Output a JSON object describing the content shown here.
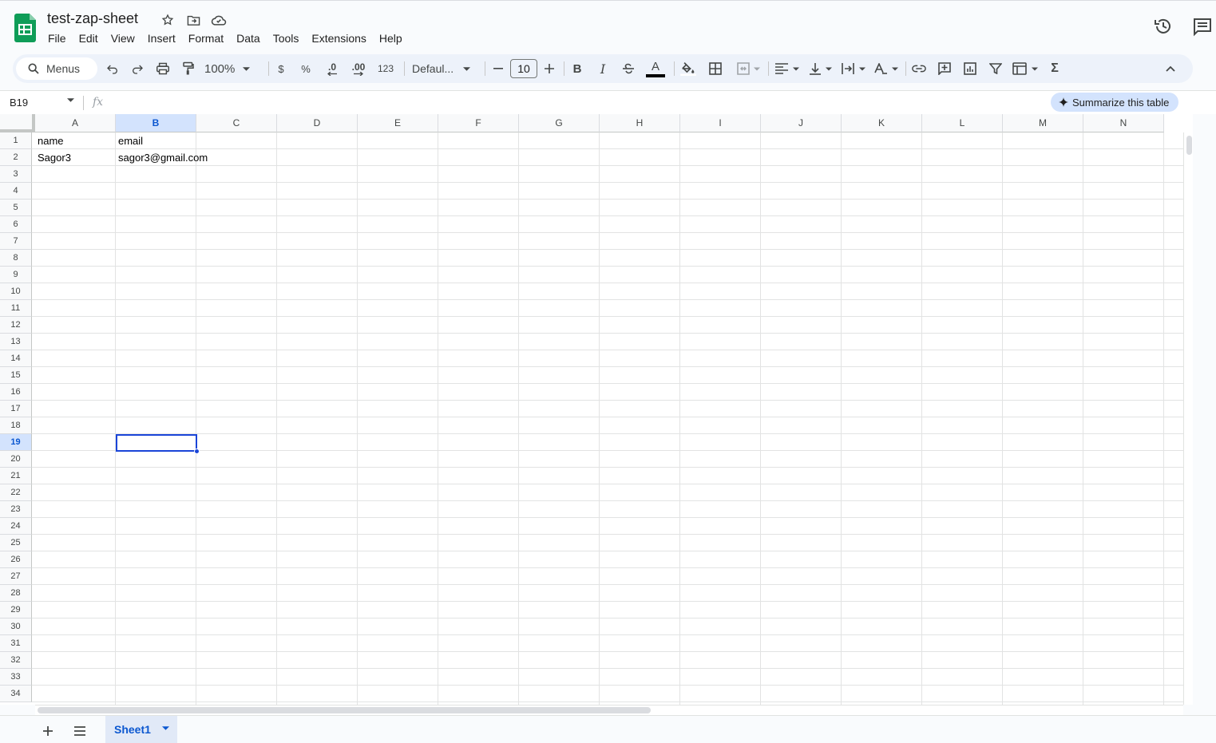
{
  "app": {
    "doc_title": "test-zap-sheet",
    "menus": [
      "File",
      "Edit",
      "View",
      "Insert",
      "Format",
      "Data",
      "Tools",
      "Extensions",
      "Help"
    ]
  },
  "toolbar": {
    "search_label": "Menus",
    "zoom": "100%",
    "currency": "$",
    "percent": "%",
    "dec_decrease": ".0",
    "dec_increase": ".00",
    "number_format": "123",
    "font": "Defaul...",
    "font_size": "10",
    "bold": "B",
    "italic": "I",
    "text_color_letter": "A"
  },
  "formula_bar": {
    "name_box": "B19",
    "fx": "fx",
    "summarize_label": "Summarize this table"
  },
  "grid": {
    "columns": [
      "A",
      "B",
      "C",
      "D",
      "E",
      "F",
      "G",
      "H",
      "I",
      "J",
      "K",
      "L",
      "M",
      "N"
    ],
    "selected_column": "B",
    "selected_row": "19",
    "row_count": 34,
    "cells": {
      "A1": "name",
      "B1": "email",
      "A2": "Sagor3",
      "B2": "sagor3@gmail.com"
    }
  },
  "sheets": {
    "tabs": [
      "Sheet1"
    ],
    "active": "Sheet1"
  },
  "colors": {
    "accent": "#0b57d0",
    "selection": "#1a45d8",
    "header_selected": "#d3e3fd",
    "logo_green": "#0f9d58"
  }
}
